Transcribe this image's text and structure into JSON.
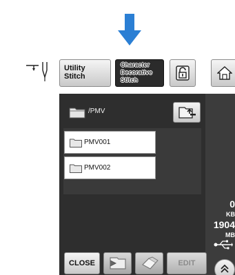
{
  "header": {
    "utility_label": "Utility\nStitch",
    "character_label": "Character\nDecorative\nStitch"
  },
  "icons": {
    "arrow": "arrow-down-icon",
    "needle": "needle-position-icon",
    "lock": "lock-icon",
    "home": "home-icon",
    "folder": "folder-icon",
    "up_folder": "folder-up-icon",
    "usb": "usb-icon",
    "scroll_up": "double-chevron-up-icon"
  },
  "browser": {
    "path": "/PMV",
    "items": [
      {
        "name": "PMV001"
      },
      {
        "name": "PMV002"
      }
    ]
  },
  "memory": {
    "free_value": "0",
    "free_unit": "KB",
    "total_value": "1904",
    "total_unit": "MB"
  },
  "footer": {
    "close_label": "CLOSE",
    "edit_label": "EDIT"
  },
  "colors": {
    "arrow_blue": "#2b7fd4",
    "panel_dark": "#2e2e2e",
    "character_button": "#2b2b2b"
  }
}
